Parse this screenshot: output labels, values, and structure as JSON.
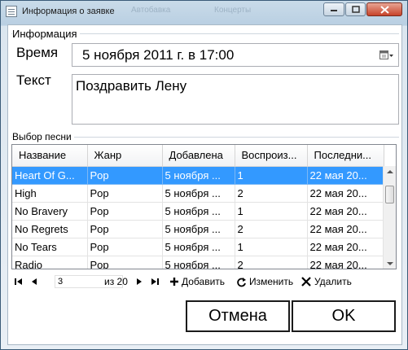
{
  "window": {
    "title": "Информация о заявке",
    "background_tabs": [
      "Автобавка",
      "Концерты"
    ]
  },
  "info_group": {
    "label": "Информация",
    "time_label": "Время",
    "time_value": "5   ноября   2011 г.  в 17:00",
    "text_label": "Текст",
    "text_value": "Поздравить Лену"
  },
  "songs_group": {
    "label": "Выбор песни",
    "columns": [
      "Название",
      "Жанр",
      "Добавлена",
      "Воспроиз...",
      "Последни..."
    ],
    "rows": [
      [
        "Heart Of G...",
        "Pop",
        "5 ноября ...",
        "1",
        "22 мая 20..."
      ],
      [
        "High",
        "Pop",
        "5 ноября ...",
        "2",
        "22 мая 20..."
      ],
      [
        "No Bravery",
        "Pop",
        "5 ноября ...",
        "1",
        "22 мая 20..."
      ],
      [
        "No Regrets",
        "Pop",
        "5 ноября ...",
        "2",
        "22 мая 20..."
      ],
      [
        "No Tears",
        "Pop",
        "5 ноября ...",
        "1",
        "22 мая 20..."
      ],
      [
        "Radio",
        "Pop",
        "5 ноября ...",
        "2",
        "22 мая 20..."
      ]
    ],
    "selected_row": 0
  },
  "navigator": {
    "position": "3",
    "total": "из 20",
    "add_label": "Добавить",
    "edit_label": "Изменить",
    "delete_label": "Удалить"
  },
  "buttons": {
    "cancel": "Отмена",
    "ok": "OK"
  },
  "colors": {
    "selection": "#3399ff",
    "frame": "#b9cfe2"
  }
}
